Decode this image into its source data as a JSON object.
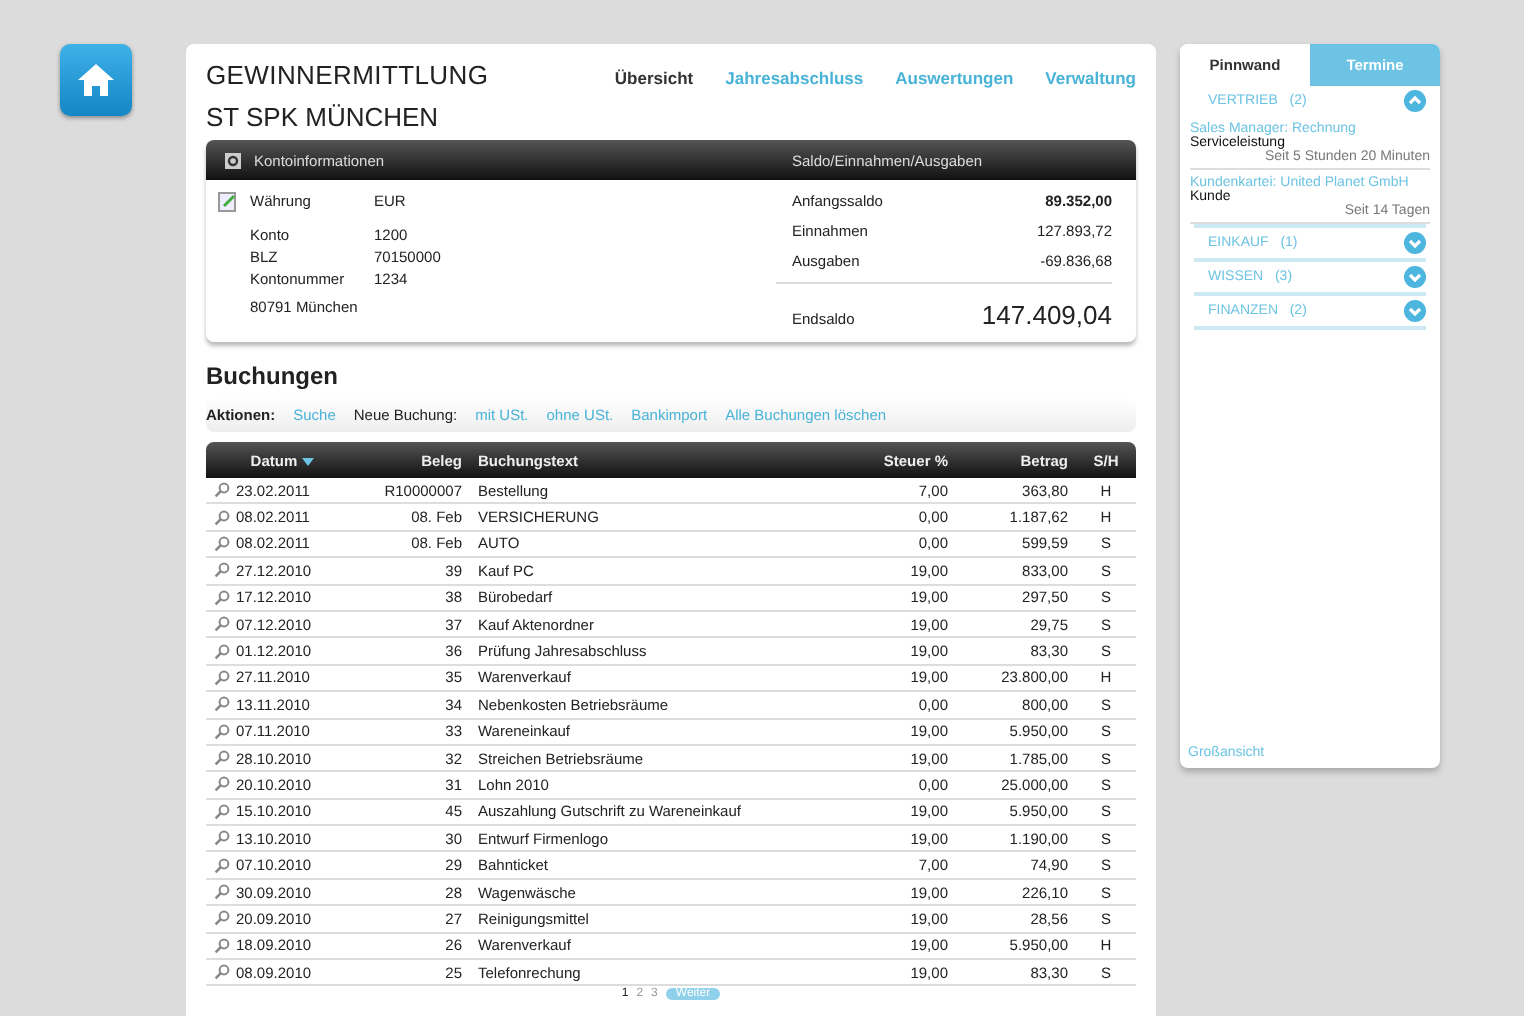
{
  "header": {
    "title": "GEWINNERMITTLUNG",
    "nav": [
      {
        "label": "Übersicht",
        "selected": true
      },
      {
        "label": "Jahresabschluss",
        "selected": false
      },
      {
        "label": "Auswertungen",
        "selected": false
      },
      {
        "label": "Verwaltung",
        "selected": false
      }
    ]
  },
  "bank_name": "ST SPK MÜNCHEN",
  "account_panel": {
    "left_title": "Kontoinformationen",
    "right_title": "Saldo/Einnahmen/Ausgaben",
    "currency": {
      "label": "Währung",
      "value": "EUR"
    },
    "fields": [
      {
        "label": "Konto",
        "value": "1200"
      },
      {
        "label": "BLZ",
        "value": "70150000"
      },
      {
        "label": "Kontonummer",
        "value": "1234"
      }
    ],
    "address": "80791  München",
    "balances": [
      {
        "label": "Anfangssaldo",
        "value": "89.352,00",
        "bold": true
      },
      {
        "label": "Einnahmen",
        "value": "127.893,72",
        "bold": false
      },
      {
        "label": "Ausgaben",
        "value": "-69.836,68",
        "bold": false
      }
    ],
    "end_balance": {
      "label": "Endsaldo",
      "value": "147.409,04"
    }
  },
  "bookings": {
    "title": "Buchungen",
    "actions": [
      {
        "kind": "label",
        "text": "Aktionen:"
      },
      {
        "kind": "link",
        "text": "Suche"
      },
      {
        "kind": "plain",
        "text": "Neue Buchung:"
      },
      {
        "kind": "link",
        "text": "mit USt."
      },
      {
        "kind": "link",
        "text": "ohne USt."
      },
      {
        "kind": "link",
        "text": "Bankimport"
      },
      {
        "kind": "link",
        "text": "Alle Buchungen löschen"
      }
    ],
    "columns": [
      {
        "label": "Datum",
        "sorted": true
      },
      {
        "label": "Beleg",
        "sorted": false
      },
      {
        "label": "Buchungstext",
        "sorted": false
      },
      {
        "label": "Steuer %",
        "sorted": false
      },
      {
        "label": "Betrag",
        "sorted": false
      },
      {
        "label": "S/H",
        "sorted": false
      }
    ],
    "rows": [
      [
        "23.02.2011",
        "R10000007",
        "Bestellung",
        "7,00",
        "363,80",
        "H"
      ],
      [
        "08.02.2011",
        "08. Feb",
        "VERSICHERUNG",
        "0,00",
        "1.187,62",
        "H"
      ],
      [
        "08.02.2011",
        "08. Feb",
        "AUTO",
        "0,00",
        "599,59",
        "S"
      ],
      [
        "27.12.2010",
        "39",
        "Kauf PC",
        "19,00",
        "833,00",
        "S"
      ],
      [
        "17.12.2010",
        "38",
        "Bürobedarf",
        "19,00",
        "297,50",
        "S"
      ],
      [
        "07.12.2010",
        "37",
        "Kauf Aktenordner",
        "19,00",
        "29,75",
        "S"
      ],
      [
        "01.12.2010",
        "36",
        "Prüfung Jahresabschluss",
        "19,00",
        "83,30",
        "S"
      ],
      [
        "27.11.2010",
        "35",
        "Warenverkauf",
        "19,00",
        "23.800,00",
        "H"
      ],
      [
        "13.11.2010",
        "34",
        "Nebenkosten Betriebsräume",
        "0,00",
        "800,00",
        "S"
      ],
      [
        "07.11.2010",
        "33",
        "Wareneinkauf",
        "19,00",
        "5.950,00",
        "S"
      ],
      [
        "28.10.2010",
        "32",
        "Streichen Betriebsräume",
        "19,00",
        "1.785,00",
        "S"
      ],
      [
        "20.10.2010",
        "31",
        "Lohn 2010",
        "0,00",
        "25.000,00",
        "S"
      ],
      [
        "15.10.2010",
        "45",
        "Auszahlung Gutschrift zu Wareneinkauf",
        "19,00",
        "5.950,00",
        "S"
      ],
      [
        "13.10.2010",
        "30",
        "Entwurf Firmenlogo",
        "19,00",
        "1.190,00",
        "S"
      ],
      [
        "07.10.2010",
        "29",
        "Bahnticket",
        "7,00",
        "74,90",
        "S"
      ],
      [
        "30.09.2010",
        "28",
        "Wagenwäsche",
        "19,00",
        "226,10",
        "S"
      ],
      [
        "20.09.2010",
        "27",
        "Reinigungsmittel",
        "19,00",
        "28,56",
        "S"
      ],
      [
        "18.09.2010",
        "26",
        "Warenverkauf",
        "19,00",
        "5.950,00",
        "H"
      ],
      [
        "08.09.2010",
        "25",
        "Telefonrechung",
        "19,00",
        "83,30",
        "S"
      ]
    ],
    "pagination": {
      "pages": [
        {
          "label": "1",
          "selected": true
        },
        {
          "label": "2",
          "selected": false
        },
        {
          "label": "3",
          "selected": false
        }
      ],
      "next": "Weiter"
    }
  },
  "sidebar": {
    "tabs": [
      {
        "label": "Pinnwand",
        "selected": true
      },
      {
        "label": "Termine",
        "selected": false
      }
    ],
    "sections": [
      {
        "title": "VERTRIEB",
        "count": "(2)",
        "expanded": true,
        "entries": [
          {
            "title": "Sales Manager: Rechnung",
            "subtitle": "Serviceleistung",
            "time": "Seit 5 Stunden 20 Minuten"
          },
          {
            "title": "Kundenkartei: United Planet GmbH",
            "subtitle": "Kunde",
            "time": "Seit 14 Tagen"
          }
        ]
      },
      {
        "title": "EINKAUF",
        "count": "(1)",
        "expanded": false
      },
      {
        "title": "WISSEN",
        "count": "(3)",
        "expanded": false
      },
      {
        "title": "FINANZEN",
        "count": "(2)",
        "expanded": false
      }
    ],
    "footer_link": "Großansicht"
  }
}
